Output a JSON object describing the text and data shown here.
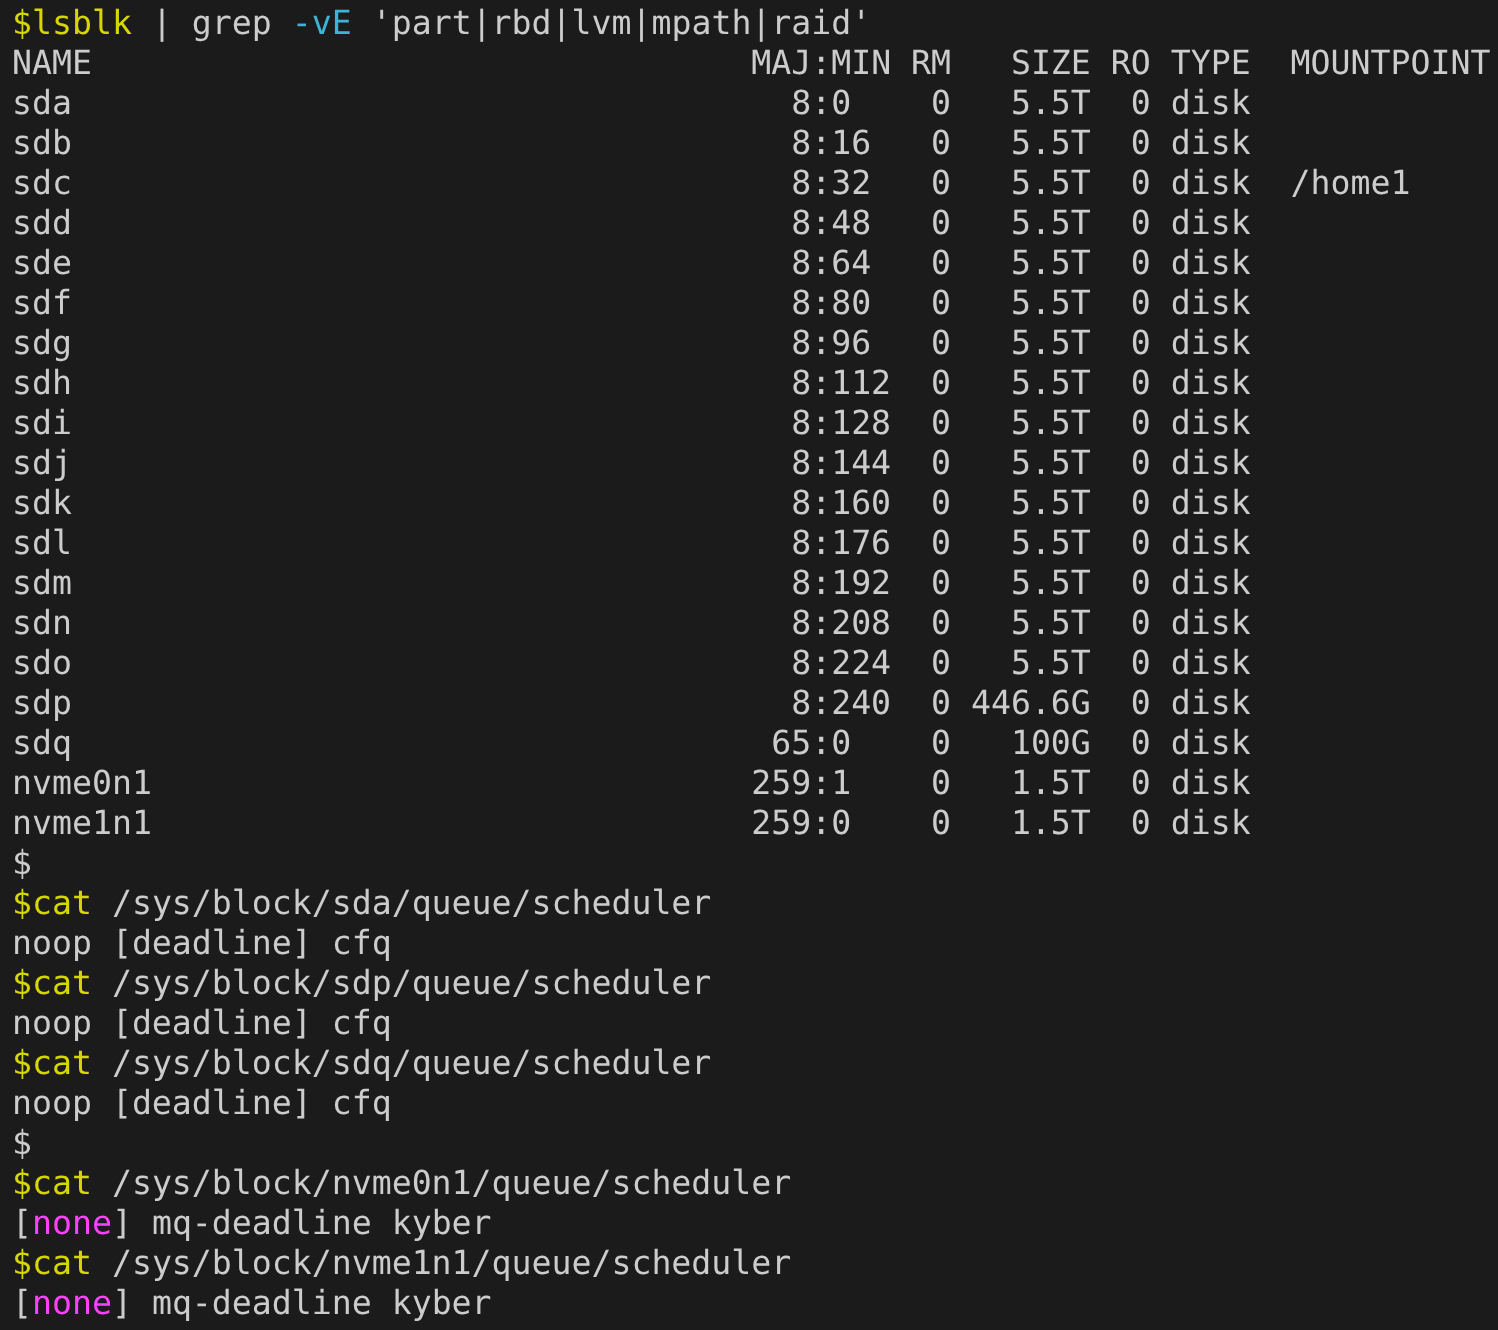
{
  "terminal": {
    "lines": [
      {
        "kind": "command",
        "segments": [
          {
            "kind": "prompt",
            "text": "$lsblk"
          },
          {
            "kind": "plain",
            "text": " | grep "
          },
          {
            "kind": "option",
            "text": "-vE"
          },
          {
            "kind": "plain",
            "text": " 'part|rbd|lvm|mpath|raid'"
          }
        ]
      },
      {
        "kind": "table",
        "columns": [
          "NAME",
          "MAJ:MIN",
          "RM",
          "SIZE",
          "RO",
          "TYPE",
          "MOUNTPOINT"
        ],
        "rows": [
          [
            "sda",
            "8:0",
            "0",
            "5.5T",
            "0",
            "disk",
            ""
          ],
          [
            "sdb",
            "8:16",
            "0",
            "5.5T",
            "0",
            "disk",
            ""
          ],
          [
            "sdc",
            "8:32",
            "0",
            "5.5T",
            "0",
            "disk",
            "/home1"
          ],
          [
            "sdd",
            "8:48",
            "0",
            "5.5T",
            "0",
            "disk",
            ""
          ],
          [
            "sde",
            "8:64",
            "0",
            "5.5T",
            "0",
            "disk",
            ""
          ],
          [
            "sdf",
            "8:80",
            "0",
            "5.5T",
            "0",
            "disk",
            ""
          ],
          [
            "sdg",
            "8:96",
            "0",
            "5.5T",
            "0",
            "disk",
            ""
          ],
          [
            "sdh",
            "8:112",
            "0",
            "5.5T",
            "0",
            "disk",
            ""
          ],
          [
            "sdi",
            "8:128",
            "0",
            "5.5T",
            "0",
            "disk",
            ""
          ],
          [
            "sdj",
            "8:144",
            "0",
            "5.5T",
            "0",
            "disk",
            ""
          ],
          [
            "sdk",
            "8:160",
            "0",
            "5.5T",
            "0",
            "disk",
            ""
          ],
          [
            "sdl",
            "8:176",
            "0",
            "5.5T",
            "0",
            "disk",
            ""
          ],
          [
            "sdm",
            "8:192",
            "0",
            "5.5T",
            "0",
            "disk",
            ""
          ],
          [
            "sdn",
            "8:208",
            "0",
            "5.5T",
            "0",
            "disk",
            ""
          ],
          [
            "sdo",
            "8:224",
            "0",
            "5.5T",
            "0",
            "disk",
            ""
          ],
          [
            "sdp",
            "8:240",
            "0",
            "446.6G",
            "0",
            "disk",
            ""
          ],
          [
            "sdq",
            "65:0",
            "0",
            "100G",
            "0",
            "disk",
            ""
          ],
          [
            "nvme0n1",
            "259:1",
            "0",
            "1.5T",
            "0",
            "disk",
            ""
          ],
          [
            "nvme1n1",
            "259:0",
            "0",
            "1.5T",
            "0",
            "disk",
            ""
          ]
        ]
      },
      {
        "kind": "command",
        "segments": [
          {
            "kind": "plain",
            "text": "$"
          }
        ]
      },
      {
        "kind": "command",
        "segments": [
          {
            "kind": "prompt",
            "text": "$cat"
          },
          {
            "kind": "plain",
            "text": " /sys/block/sda/queue/scheduler"
          }
        ]
      },
      {
        "kind": "output",
        "segments": [
          {
            "kind": "plain",
            "text": "noop [deadline] cfq"
          }
        ]
      },
      {
        "kind": "command",
        "segments": [
          {
            "kind": "prompt",
            "text": "$cat"
          },
          {
            "kind": "plain",
            "text": " /sys/block/sdp/queue/scheduler"
          }
        ]
      },
      {
        "kind": "output",
        "segments": [
          {
            "kind": "plain",
            "text": "noop [deadline] cfq"
          }
        ]
      },
      {
        "kind": "command",
        "segments": [
          {
            "kind": "prompt",
            "text": "$cat"
          },
          {
            "kind": "plain",
            "text": " /sys/block/sdq/queue/scheduler"
          }
        ]
      },
      {
        "kind": "output",
        "segments": [
          {
            "kind": "plain",
            "text": "noop [deadline] cfq"
          }
        ]
      },
      {
        "kind": "command",
        "segments": [
          {
            "kind": "plain",
            "text": "$"
          }
        ]
      },
      {
        "kind": "command",
        "segments": [
          {
            "kind": "prompt",
            "text": "$cat"
          },
          {
            "kind": "plain",
            "text": " /sys/block/nvme0n1/queue/scheduler"
          }
        ]
      },
      {
        "kind": "output",
        "segments": [
          {
            "kind": "plain",
            "text": "["
          },
          {
            "kind": "highlight",
            "text": "none"
          },
          {
            "kind": "plain",
            "text": "] mq-deadline kyber"
          }
        ]
      },
      {
        "kind": "command",
        "segments": [
          {
            "kind": "prompt",
            "text": "$cat"
          },
          {
            "kind": "plain",
            "text": " /sys/block/nvme1n1/queue/scheduler"
          }
        ]
      },
      {
        "kind": "output",
        "segments": [
          {
            "kind": "plain",
            "text": "["
          },
          {
            "kind": "highlight",
            "text": "none"
          },
          {
            "kind": "plain",
            "text": "] mq-deadline kyber"
          }
        ]
      }
    ]
  }
}
